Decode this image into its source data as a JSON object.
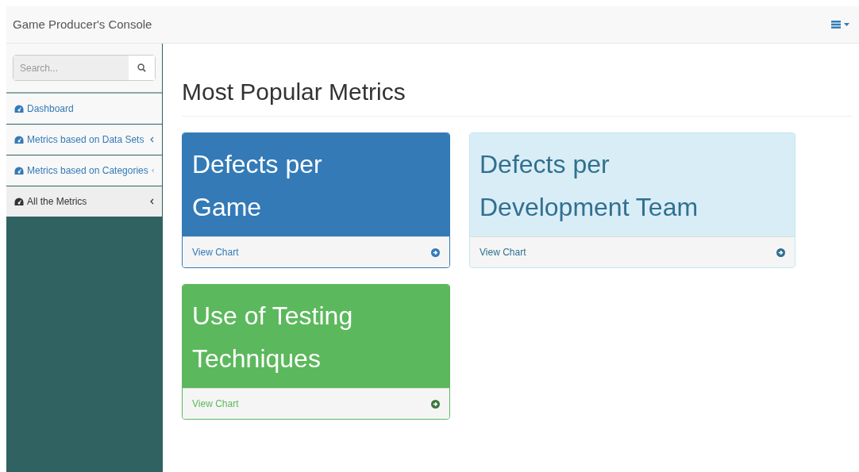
{
  "navbar": {
    "brand": "Game Producer's Console"
  },
  "sidebar": {
    "search": {
      "placeholder": "Search..."
    },
    "items": [
      {
        "label": "Dashboard",
        "has_submenu": false,
        "selected": false
      },
      {
        "label": "Metrics based on Data Sets",
        "has_submenu": true,
        "selected": false
      },
      {
        "label": "Metrics based on Categories",
        "has_submenu": true,
        "selected": false
      },
      {
        "label": "All the Metrics",
        "has_submenu": true,
        "selected": true
      }
    ]
  },
  "page_title": "Most Popular Metrics",
  "cards": [
    {
      "kind": "primary",
      "title": "Defects per Game",
      "link": "View Chart"
    },
    {
      "kind": "info",
      "title": "Defects per Development Team",
      "link": "View Chart"
    },
    {
      "kind": "success",
      "title": "Use of Testing Techniques",
      "link": "View Chart"
    }
  ]
}
